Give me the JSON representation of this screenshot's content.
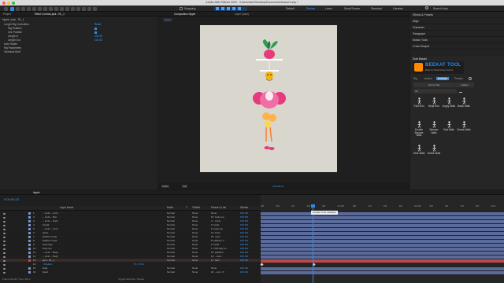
{
  "window": {
    "title": "Adobe After Effects 2022 - /Users/user/Desktop/Documents/lesson3.aep *"
  },
  "toolbar": {
    "snapping_label": "Snapping",
    "workspaces": [
      "Default",
      "Review",
      "Learn",
      "Small Screen",
      "Standard",
      "Libraries"
    ],
    "active_workspace": "Review",
    "search_placeholder": "Search Help"
  },
  "left_panel": {
    "tabs": [
      "Project",
      "Effect Controls jack - RL_1"
    ],
    "header": "hippie • jack - RL_1",
    "rows": [
      {
        "label": "Length Rig Controllers",
        "value": "Reset",
        "indent": 1
      },
      {
        "label": "Rig Rotation",
        "value": "checkbox",
        "indent": 2
      },
      {
        "label": "Link Position",
        "value": "checkbox",
        "indent": 2
      },
      {
        "label": "Length In",
        "value": "100.00",
        "indent": 2
      },
      {
        "label": "Length Out",
        "value": "100.00",
        "indent": 2
      },
      {
        "label": "Auto Rotate",
        "value": "",
        "indent": 1
      },
      {
        "label": "Rig Parameters",
        "value": "",
        "indent": 1
      },
      {
        "label": "Technical Stuff",
        "value": "",
        "indent": 1
      }
    ]
  },
  "composition": {
    "tabs": [
      "Composition hippie"
    ],
    "sub_tab": "hippie",
    "layer_tab": "Layer (none)",
    "footer": {
      "zoom": "100%",
      "resolution": "Full",
      "timecode": "0:00:00:13"
    }
  },
  "right_panel": {
    "items": [
      "Effects & Presets",
      "Align",
      "Character",
      "Paragraph",
      "Motion Tools",
      "Cross Shapes"
    ],
    "duik": {
      "title": "Duik Bassel",
      "banner": "BEEKAT TOOL",
      "banner_sub": "Made by MotionDesign School",
      "tabs": [
        "Rig",
        "Anchor",
        "Animate",
        "Presets"
      ],
      "active_tab": "Animate",
      "buttons": [
        "Set Up Rig",
        "Gallery"
      ],
      "filter": "All",
      "poses": [
        "Fast Run",
        "Ninja Run",
        "Angry Walk",
        "Basic Walk",
        "Double Bounce Walk",
        "Woman Walk",
        "Sad Walk",
        "Sneak Walk",
        "Strut Walk",
        "Robot Walk"
      ]
    }
  },
  "timeline": {
    "tab": "hippie",
    "timecode": "0:00:00:13",
    "columns": [
      "Layer Name",
      "Mode",
      "T",
      "TrkMat",
      "Parent & Link",
      "Stretch"
    ],
    "tooltip": "Current Time Indicator",
    "ruler": [
      "00f",
      "05f",
      "10f",
      "15f",
      "20f",
      "01:00f",
      "05f",
      "10f",
      "15f",
      "20f",
      "02:00f",
      "05f",
      "10f",
      "15f",
      "20f",
      "03:0"
    ],
    "footer": "Frame Render Time: 41ms",
    "footer2": "Toggle Switches / Modes",
    "layers": [
      {
        "n": "1",
        "name": "-- Limb -- Limb",
        "mode": "Normal",
        "trk": "None",
        "parent": "None",
        "stretch": "100.0%",
        "color": "#7b97c8"
      },
      {
        "n": "2",
        "name": "-- Limb -- Bun",
        "mode": "Normal",
        "trk": "None",
        "parent": "15. body top",
        "stretch": "100.0%",
        "color": "#7b97c8"
      },
      {
        "n": "3",
        "name": "-- Limb -- Stem",
        "mode": "Normal",
        "trk": "None",
        "parent": "4. - Limb -",
        "stretch": "100.0%",
        "color": "#7b97c8"
      },
      {
        "n": "4",
        "name": "head2",
        "mode": "Normal",
        "trk": "None",
        "parent": "9. head",
        "stretch": "100.0%",
        "color": "#7b97c8"
      },
      {
        "n": "5",
        "name": "-- Limb -- Limb",
        "mode": "Normal",
        "trk": "None",
        "parent": "9. body top",
        "stretch": "100.0%",
        "color": "#7b97c8"
      },
      {
        "n": "6",
        "name": "plane",
        "mode": "Normal",
        "trk": "None",
        "parent": "10. body",
        "stretch": "100.0%",
        "color": "#7b97c8"
      },
      {
        "n": "7",
        "name": "platform body",
        "mode": "Normal",
        "trk": "None",
        "parent": "15. none",
        "stretch": "100.0%",
        "color": "#7b97c8"
      },
      {
        "n": "8",
        "name": "platform head",
        "mode": "Normal",
        "trk": "None",
        "parent": "8. platform h",
        "stretch": "100.0%",
        "color": "#7b97c8"
      },
      {
        "n": "9",
        "name": "body legs",
        "mode": "Normal",
        "trk": "None",
        "parent": "9. head",
        "stretch": "100.0%",
        "color": "#7b97c8"
      },
      {
        "n": "10",
        "name": "body top",
        "mode": "Normal",
        "trk": "None",
        "parent": "1. OTE Rig Co",
        "stretch": "100.0%",
        "color": "#7b97c8"
      },
      {
        "n": "11",
        "name": "-- Limb -- Body",
        "mode": "Normal",
        "trk": "None",
        "parent": "15. platform",
        "stretch": "100.0%",
        "color": "#7b97c8"
      },
      {
        "n": "12",
        "name": "-- Limb -- Body",
        "mode": "Normal",
        "trk": "None",
        "parent": "16. - start -",
        "stretch": "100.0%",
        "color": "#7b97c8"
      },
      {
        "n": "13",
        "name": "jack - RL_1",
        "mode": "Normal",
        "trk": "None",
        "parent": "17. start",
        "stretch": "100.0%",
        "color": "#c04848",
        "selected": true
      },
      {
        "n": "14",
        "name": "  Position",
        "mode": "",
        "trk": "",
        "parent": "",
        "stretch": "",
        "color": "",
        "sub": true,
        "value": "70, 170.9"
      },
      {
        "n": "15",
        "name": "body",
        "mode": "Normal",
        "trk": "None",
        "parent": "None",
        "stretch": "100.0%",
        "color": "#7b97c8"
      },
      {
        "n": "16",
        "name": "head",
        "mode": "Normal",
        "trk": "None",
        "parent": "24. - end - P",
        "stretch": "100.0%",
        "color": "#7b97c8"
      }
    ]
  },
  "colors": {
    "accent": "#2d8ceb",
    "selected_layer": "#c04848",
    "timeline_bar": "#5a6a9a",
    "canvas_bg": "#d9d6ce"
  }
}
